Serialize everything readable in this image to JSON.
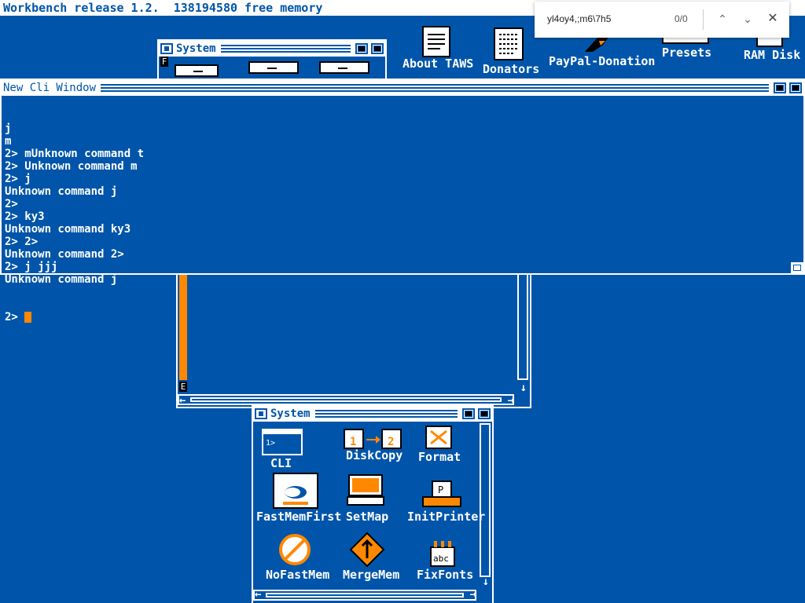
{
  "screen": {
    "title": "Workbench release 1.2.  138194580 free memory"
  },
  "desktop_icons": [
    {
      "name": "About TAWS",
      "icon": "document-icon"
    },
    {
      "name": "Donators",
      "icon": "document-icon"
    },
    {
      "name": "PayPal-Donation",
      "icon": "tool-icon"
    },
    {
      "name": "Presets",
      "icon": "drawer-icon"
    },
    {
      "name": "RAM Disk",
      "icon": "disk-icon"
    }
  ],
  "system_back_window": {
    "title": "System",
    "letter_top": "F",
    "letter_bottom": "E"
  },
  "cli_window": {
    "title": "New Cli Window",
    "lines": [
      "j",
      "m",
      "2> mUnknown command t",
      "2> Unknown command m",
      "2> j",
      "Unknown command j",
      "2>",
      "2> ky3",
      "Unknown command ky3",
      "2> 2>",
      "Unknown command 2>",
      "2> j jjj",
      "Unknown command j"
    ],
    "prompt": "2> "
  },
  "system_window": {
    "title": "System",
    "icons": [
      {
        "label": "CLI",
        "icon": "cli-icon"
      },
      {
        "label": "DiskCopy",
        "icon": "diskcopy-icon"
      },
      {
        "label": "Format",
        "icon": "format-icon"
      },
      {
        "label": "FastMemFirst",
        "icon": "rabbit-icon"
      },
      {
        "label": "SetMap",
        "icon": "keymap-icon"
      },
      {
        "label": "InitPrinter",
        "icon": "printer-icon"
      },
      {
        "label": "NoFastMem",
        "icon": "no-rabbit-icon"
      },
      {
        "label": "MergeMem",
        "icon": "merge-icon"
      },
      {
        "label": "FixFonts",
        "icon": "fonts-icon"
      }
    ]
  },
  "findbar": {
    "query": "yl4oy4,;m6\\7h5",
    "count": "0/0"
  },
  "colors": {
    "background": "#0055aa",
    "white": "#ffffff",
    "orange": "#ff8800",
    "black": "#000000"
  }
}
